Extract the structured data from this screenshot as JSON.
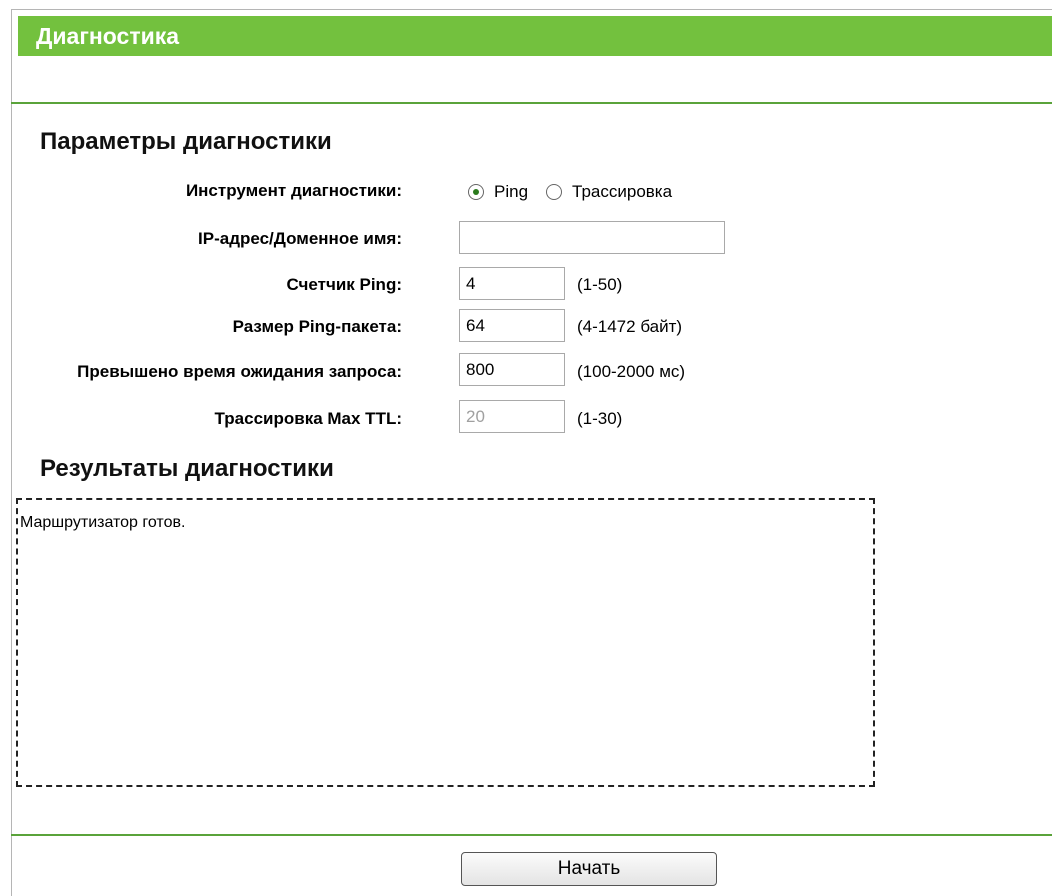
{
  "header": {
    "title": "Диагностика"
  },
  "params": {
    "section_title": "Параметры диагностики",
    "tool": {
      "label": "Инструмент диагностики:",
      "options": [
        "Ping",
        "Трассировка"
      ],
      "selected": "Ping"
    },
    "ip": {
      "label": "IP-адрес/Доменное имя:",
      "value": ""
    },
    "ping_count": {
      "label": "Счетчик Ping:",
      "value": "4",
      "hint": "(1-50)"
    },
    "ping_size": {
      "label": "Размер Ping-пакета:",
      "value": "64",
      "hint": "(4-1472 байт)"
    },
    "timeout": {
      "label": "Превышено время ожидания запроса:",
      "value": "800",
      "hint": "(100-2000 мс)"
    },
    "max_ttl": {
      "label": "Трассировка Max TTL:",
      "value": "20",
      "hint": "(1-30)"
    }
  },
  "results": {
    "section_title": "Результаты диагностики",
    "text": "Маршрутизатор готов."
  },
  "actions": {
    "start_label": "Начать"
  },
  "colors": {
    "accent": "#73c13e",
    "rule": "#5aa33a"
  }
}
